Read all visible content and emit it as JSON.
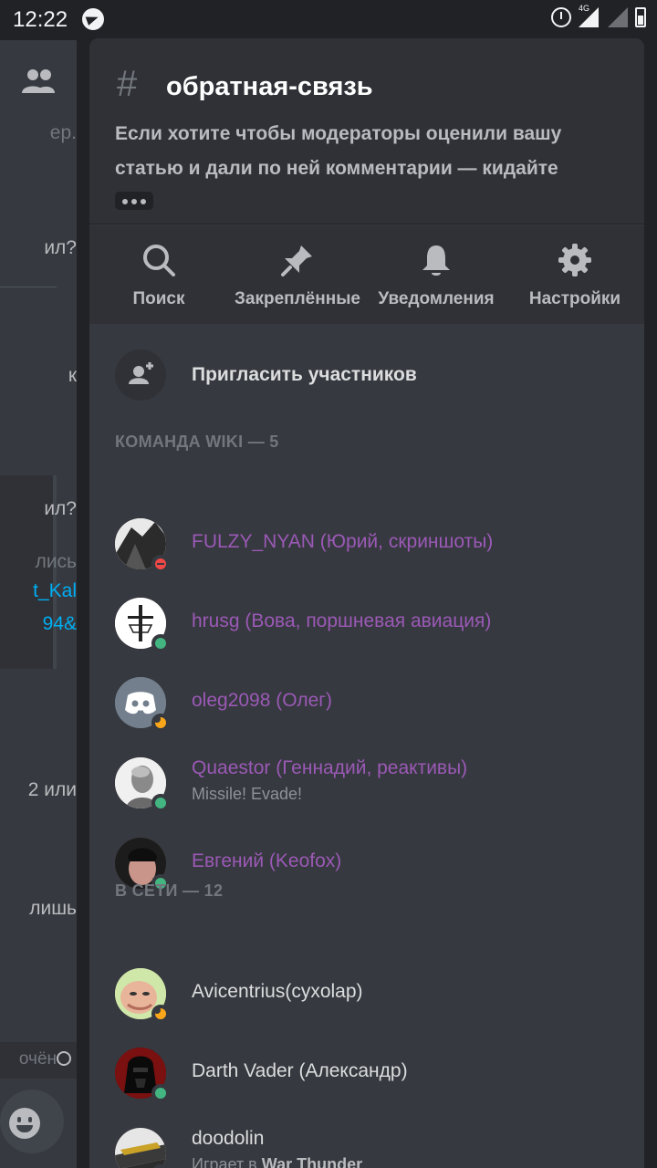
{
  "status_bar": {
    "time": "12:22",
    "network": "4G"
  },
  "background": {
    "fragments": [
      "ер.",
      "ил?",
      "к",
      "ил?",
      "лись",
      "t_Kal",
      "94&",
      "2 или",
      "лишь",
      "очён"
    ]
  },
  "channel": {
    "name": "обратная-связь",
    "topic": "Если хотите чтобы модераторы оценили вашу статью и дали по ней комментарии — кидайте"
  },
  "toolbar": {
    "search_label": "Поиск",
    "pinned_label": "Закреплённые",
    "notifications_label": "Уведомления",
    "settings_label": "Настройки"
  },
  "invite": {
    "label": "Пригласить участников"
  },
  "sections": {
    "team_header": "КОМАНДА WIKI — 5",
    "online_header": "В СЕТИ — 12"
  },
  "team_members": [
    {
      "name": "FULZY_NYAN (Юрий, скриншоты)",
      "status": "dnd"
    },
    {
      "name": "hrusg (Вова, поршневая авиация)",
      "status": "online"
    },
    {
      "name": "oleg2098 (Олег)",
      "status": "idle"
    },
    {
      "name": "Quaestor (Геннадий, реактивы)",
      "activity": "Missile! Evade!",
      "status": "online"
    },
    {
      "name": "Евгений (Keofox)",
      "status": "online"
    }
  ],
  "online_members": [
    {
      "name": "Avicentrius(cyxolap)",
      "status": "idle"
    },
    {
      "name": "Darth Vader (Александр)",
      "status": "online"
    },
    {
      "name": "doodolin",
      "activity_prefix": "Играет в ",
      "activity_game": "War Thunder",
      "status": "idle"
    }
  ],
  "colors": {
    "role": "#9b59b6",
    "online": "#43b581",
    "idle": "#faa61a",
    "dnd": "#f04747",
    "link": "#00aff4"
  }
}
